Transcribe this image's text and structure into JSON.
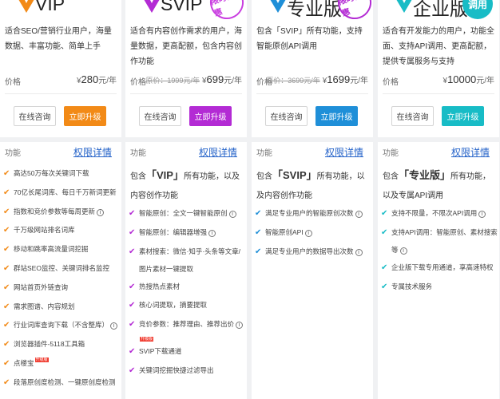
{
  "plans": [
    {
      "name": "VIP",
      "color": "#f28a17",
      "description": "适合SEO/营销行业用户，海量数据、丰富功能、简单上手",
      "price_label": "价格",
      "price_old": "",
      "price_symbol": "¥",
      "price": "280",
      "price_unit": "元/年",
      "consult_label": "在线咨询",
      "upgrade_label": "立即升级",
      "features_label": "功能",
      "details_link": "权限详情",
      "includes_prefix": "",
      "includes_name": "",
      "includes_suffix": "",
      "features": [
        {
          "text": "高达50万每次关键词下载"
        },
        {
          "text": "70亿长尾词库、每日千万新词更新"
        },
        {
          "text": "指数和竞价参数等每周更新",
          "info": "i"
        },
        {
          "text": "千万级网站排名词库"
        },
        {
          "text": "移动和跳率高流量词挖掘"
        },
        {
          "text": "群站SEO监控、关键词排名监控"
        },
        {
          "text": "网站首页外链查询"
        },
        {
          "text": "需求图谱、内容规划"
        },
        {
          "text": "行业词库查询下载（不含整库）",
          "info": "i"
        },
        {
          "text": "浏览器插件-5118工具箱"
        },
        {
          "text": "点楼宝",
          "hot": "升级版"
        },
        {
          "text": "段落原创度检测、一键原创度检测"
        }
      ]
    },
    {
      "name": "SVIP",
      "color": "#b32bd4",
      "seal": "限时优惠",
      "description": "适合有内容创作需求的用户，海量数据，更高配额，包含内容创作功能",
      "price_label": "价格",
      "price_old": "原价：1999元/年",
      "price_symbol": "¥",
      "price": "699",
      "price_unit": "元/年",
      "consult_label": "在线咨询",
      "upgrade_label": "立即升级",
      "features_label": "功能",
      "details_link": "权限详情",
      "includes_prefix": "包含",
      "includes_name": "「VIP」",
      "includes_suffix": "所有功能，以及内容创作功能",
      "features": [
        {
          "text": "智能原创：全文一键智能原创",
          "info": "i"
        },
        {
          "text": "智能原创：编辑器增强",
          "info": "i"
        },
        {
          "text": "素材搜索：微信·知乎·头条等文章/图片素材一键提取",
          "two": true
        },
        {
          "text": "热搜热点素材"
        },
        {
          "text": "核心词提取，摘要提取"
        },
        {
          "text": "竞价参数：推荐理由、推荐出价",
          "info": "i",
          "hot_below": "升级版"
        },
        {
          "text": "SVIP下载通道"
        },
        {
          "text": "关键词挖掘快捷过滤导出"
        }
      ]
    },
    {
      "name": "专业版",
      "color": "#1f8fd8",
      "seal": "限时优惠",
      "description": "包含「SVIP」所有功能，支持智能原创API调用",
      "price_label": "价格",
      "price_old": "原价：3699元/年",
      "price_symbol": "¥",
      "price": "1699",
      "price_unit": "元/年",
      "consult_label": "在线咨询",
      "upgrade_label": "立即升级",
      "features_label": "功能",
      "details_link": "权限详情",
      "includes_prefix": "包含",
      "includes_name": "「SVIP」",
      "includes_suffix": "所有功能，以及内容创作功能",
      "features": [
        {
          "text": "满足专业用户的智能原创次数",
          "info": "i"
        },
        {
          "text": "智能原创API",
          "info": "i"
        },
        {
          "text": "满足专业用户的数据导出次数",
          "info": "i"
        }
      ]
    },
    {
      "name": "企业版",
      "color": "#18bcc6",
      "pill": "调用",
      "description": "适合有开发能力的用户，功能全面、支持API调用、更高配额，提供专属服务与支持",
      "price_label": "价格",
      "price_old": "",
      "price_symbol": "¥",
      "price": "10000",
      "price_unit": "元/年",
      "consult_label": "在线咨询",
      "upgrade_label": "立即升级",
      "features_label": "功能",
      "details_link": "权限详情",
      "includes_prefix": "包含",
      "includes_name": "「专业版」",
      "includes_suffix": "所有功能，以及专属API调用",
      "features": [
        {
          "text": "支持不限量，不限次API调用",
          "info": "i"
        },
        {
          "text": "支持API调用：智能原创、素材搜索等",
          "info": "i",
          "two": true
        },
        {
          "text": "企业版下载专用通道，享高速特权"
        },
        {
          "text": "专属技术服务"
        }
      ]
    }
  ],
  "upgrade_colors": [
    "#f28a17",
    "#b32bd4",
    "#1f8fd8",
    "#18bcc6"
  ]
}
